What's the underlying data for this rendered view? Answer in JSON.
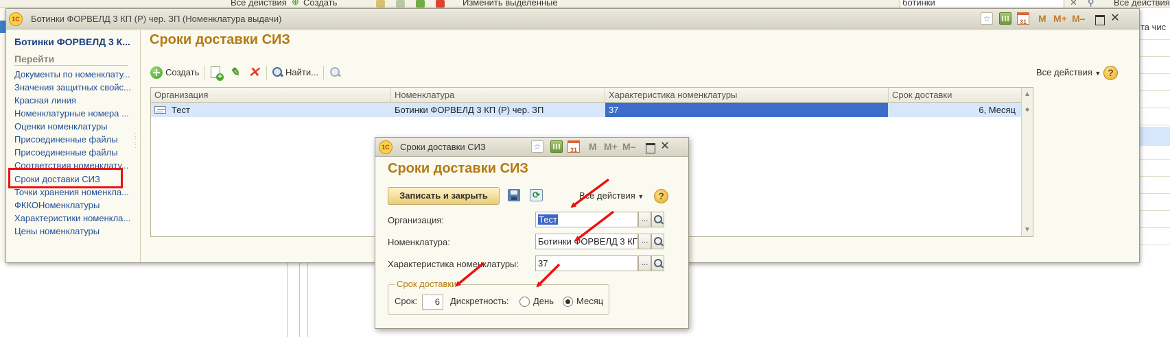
{
  "background_app": {
    "toolbar": {
      "all_actions": "Все действия",
      "create": "Создать",
      "edit_selected": "Изменить выделенные",
      "search_value": "ботинки",
      "all_actions_right": "Все действия"
    },
    "right_fragment": "та чис"
  },
  "main_window": {
    "title": "Ботинки ФОРВЕЛД 3 КП (Р) чер. ЗП (Номенклатура выдачи)",
    "logo": "1С",
    "title_buttons": [
      "star-icon",
      "calculator-icon",
      "calendar-icon",
      "M",
      "M+",
      "M-",
      "maximize-icon",
      "close-icon"
    ],
    "calendar_day": "31",
    "sidebar": {
      "title": "Ботинки ФОРВЕЛД 3 К...",
      "section": "Перейти",
      "items": [
        "Документы по номенклату...",
        "Значения защитных свойс...",
        "Красная линия",
        "Номенклатурные номера ...",
        "Оценки номенклатуры",
        "Присоединенные файлы",
        "Присоединенные файлы",
        "Соответствия номенклату...",
        "Сроки доставки СИЗ",
        "Точки хранения номенкла...",
        "ФККОНоменклатуры",
        "Характеристики номенкла...",
        "Цены номенклатуры"
      ],
      "highlighted_item": "Сроки доставки СИЗ"
    },
    "content": {
      "title": "Сроки доставки СИЗ",
      "toolbar": {
        "create": "Создать",
        "find": "Найти...",
        "all_actions": "Все действия",
        "help": "?"
      },
      "table": {
        "columns": [
          "Организация",
          "Номенклатура",
          "Характеристика номенклатуры",
          "Срок доставки"
        ],
        "rows": [
          [
            "Тест",
            "Ботинки ФОРВЕЛД 3 КП (Р) чер. ЗП",
            "37",
            "6, Месяц"
          ]
        ]
      }
    }
  },
  "dialog": {
    "title": "Сроки доставки СИЗ",
    "logo": "1С",
    "calendar_day": "31",
    "heading": "Сроки доставки СИЗ",
    "save_close": "Записать и закрыть",
    "all_actions": "Все действия",
    "help": "?",
    "fields": {
      "organization_label": "Организация:",
      "organization_value": "Тест",
      "nomenclature_label": "Номенклатура:",
      "nomenclature_value": "Ботинки ФОРВЕЛД 3 КГ",
      "characteristic_label": "Характеристика номенклатуры:",
      "characteristic_value": "37",
      "choose_button": "...",
      "group_label": "Срок доставки",
      "term_label": "Срок:",
      "term_value": "6",
      "discreteness_label": "Дискретность:",
      "day_label": "День",
      "month_label": "Месяц",
      "selected_discreteness": "Месяц"
    }
  },
  "annotations": {
    "arrow_color": "#ee1111",
    "highlight_color": "#ee1111"
  }
}
